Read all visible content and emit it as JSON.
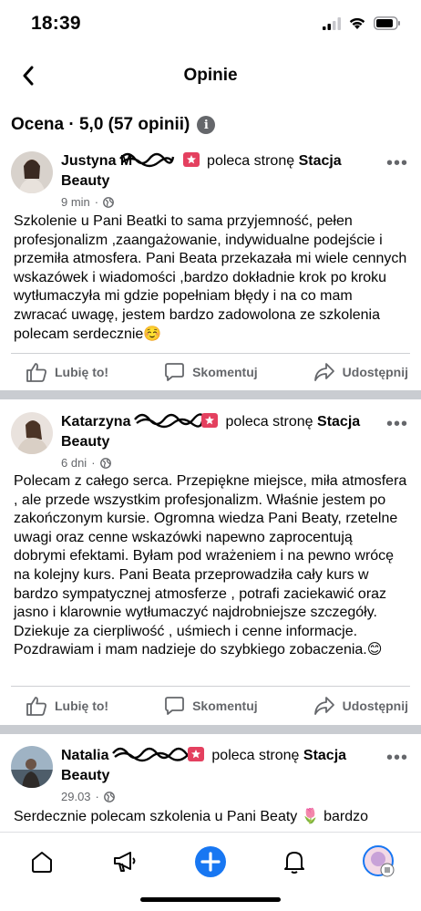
{
  "status_bar": {
    "time": "18:39"
  },
  "nav": {
    "title": "Opinie"
  },
  "rating": {
    "text": "Ocena · 5,0 (57 opinii)"
  },
  "reviews": [
    {
      "first_name": "Justyna",
      "surname_visible": "M",
      "recommends": "poleca stronę",
      "page_name": "Stacja Beauty",
      "time": "9 min",
      "body": "Szkolenie u Pani Beatki to sama przyjemność, pełen profesjonalizm ,zaangażowanie, indywidualne podejście i przemiła atmosfera. Pani Beata przekazała mi wiele cennych wskazówek i wiadomości ,bardzo dokładnie krok po kroku wytłumaczyła mi gdzie popełniam błędy i na co mam zwracać uwagę, jestem bardzo zadowolona ze szkolenia polecam serdecznie☺️"
    },
    {
      "first_name": "Katarzyna",
      "surname_visible": "",
      "recommends": "poleca stronę",
      "page_name": "Stacja Beauty",
      "time": "6 dni",
      "body": "Polecam z całego serca. Przepiękne miejsce, miła atmosfera , ale przede wszystkim profesjonalizm. Właśnie jestem po  zakończonym kursie. Ogromna wiedza Pani Beaty, rzetelne uwagi oraz cenne wskazówki napewno zaprocentują dobrymi efektami. Byłam pod wrażeniem i na pewno wrócę na kolejny kurs. Pani Beata przeprowadziła cały kurs w bardzo sympatycznej atmosferze , potrafi zaciekawić oraz jasno i klarownie wytłumaczyć najdrobniejsze szczegóły. Dziekuje za cierpliwość , uśmiech i cenne informacje. Pozdrawiam i mam nadzieje do szybkiego zobaczenia.😊"
    },
    {
      "first_name": "Natalia",
      "surname_visible": "",
      "recommends": "poleca stronę",
      "page_name": "Stacja Beauty",
      "time": "29.03",
      "body": "Serdecznie polecam szkolenia u Pani Beaty 🌷 bardzo"
    }
  ],
  "actions": {
    "like": "Lubię to!",
    "comment": "Skomentuj",
    "share": "Udostępnij"
  },
  "tabs": [
    "home-icon",
    "megaphone-icon",
    "create-icon",
    "notifications-icon",
    "profile-icon"
  ],
  "colors": {
    "accent": "#1877f2",
    "badge": "#e4405f",
    "secondary_text": "#65676b"
  }
}
